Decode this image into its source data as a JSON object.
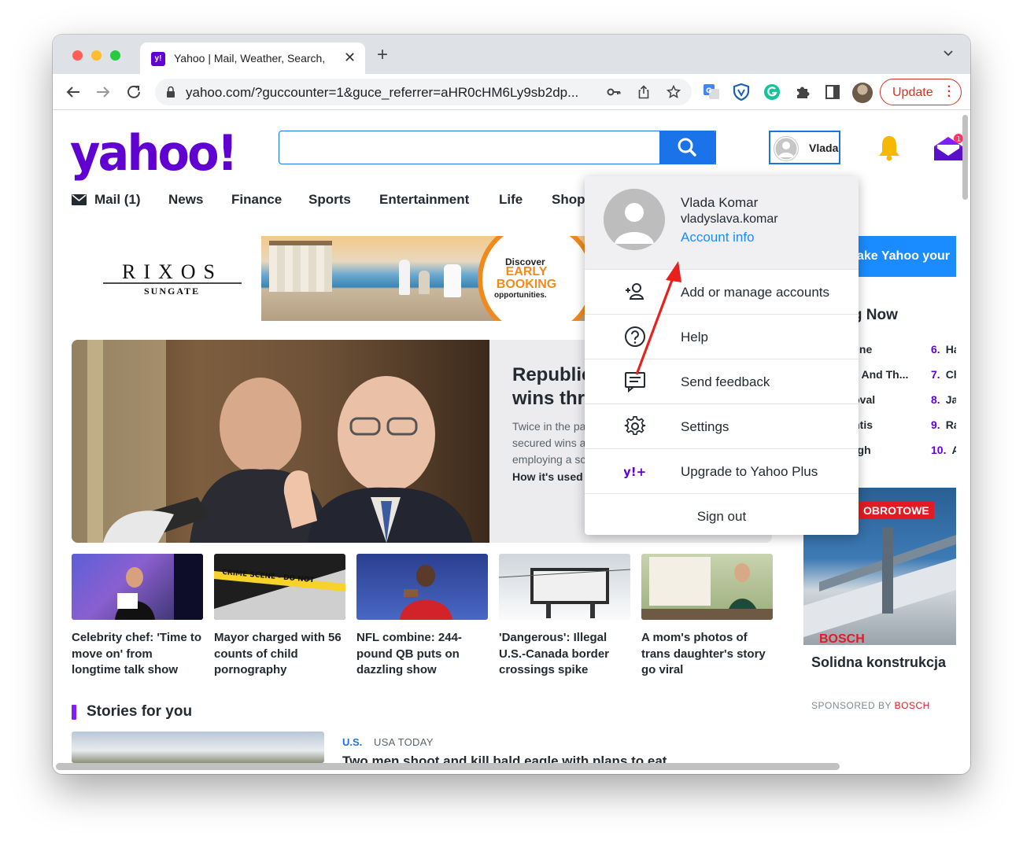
{
  "browser": {
    "tab_title": "Yahoo | Mail, Weather, Search,",
    "favicon_text": "y!",
    "url": "yahoo.com/?guccounter=1&guce_referrer=aHR0cHM6Ly9sb2dp...",
    "update_label": "Update"
  },
  "header": {
    "logo": "yahoo!",
    "search_placeholder": "",
    "user_name": "Vlada",
    "mail_badge": "1"
  },
  "nav": {
    "items": [
      "Mail (1)",
      "News",
      "Finance",
      "Sports",
      "Entertainment",
      "Life",
      "Shop"
    ]
  },
  "ads": {
    "rixos_brand": "RIXOS",
    "rixos_sub": "SUNGATE",
    "banner_discover": "Discover",
    "banner_early": "EARLY BOOKING",
    "banner_opps": "opportunities."
  },
  "hero": {
    "headline": "Republic\nwins thr",
    "sub": "Twice in the pa\nsecured wins a\nemploying a sc",
    "link": "How it's used"
  },
  "thumbs": [
    {
      "caption": "Celebrity chef: 'Time to move on' from longtime talk show"
    },
    {
      "caption": "Mayor charged with 56 counts of child pornography",
      "img_text": "CRIME SCENE - DO NOT"
    },
    {
      "caption": "NFL combine: 244-pound QB puts on dazzling show"
    },
    {
      "caption": "'Dangerous': Illegal U.S.-Canada border crossings spike"
    },
    {
      "caption": "A mom's photos of trans daughter's story go viral"
    }
  ],
  "stories": {
    "title": "Stories for you",
    "category": "U.S.",
    "source": "USA TODAY",
    "headline": "Two men shoot and kill bald eagle with plans to eat"
  },
  "right_rail": {
    "promo": "ake Yahoo your",
    "trending_title": "ing Now",
    "trending_left": [
      "mbine",
      "nes And Th...",
      "ndoval",
      "Santis",
      "rough"
    ],
    "trending_right": [
      {
        "num": "6.",
        "text": "Ha"
      },
      {
        "num": "7.",
        "text": "Ch"
      },
      {
        "num": "8.",
        "text": "Ja"
      },
      {
        "num": "9.",
        "text": "Ra"
      },
      {
        "num": "10.",
        "text": "A"
      }
    ],
    "bosch_tag": "OBROTOWE",
    "bosch_logo": "BOSCH",
    "bosch_headline": "Solidna konstrukcja",
    "sponsored_prefix": "SPONSORED BY",
    "sponsored_brand": "BOSCH"
  },
  "dropdown": {
    "name": "Vlada Komar",
    "email": "vladyslava.komar",
    "account_info": "Account info",
    "items": [
      {
        "label": "Add or manage accounts",
        "icon": "manage-accounts-icon"
      },
      {
        "label": "Help",
        "icon": "help-icon"
      },
      {
        "label": "Send feedback",
        "icon": "feedback-icon"
      },
      {
        "label": "Settings",
        "icon": "gear-icon"
      },
      {
        "label": "Upgrade to Yahoo Plus",
        "icon": "yahoo-plus-icon"
      }
    ],
    "sign_out": "Sign out"
  },
  "colors": {
    "yahoo_purple": "#6001d2",
    "search_blue": "#1a73e8",
    "link_blue": "#1a8cff",
    "annotation_red": "#e8211d",
    "update_red": "#d93025"
  }
}
